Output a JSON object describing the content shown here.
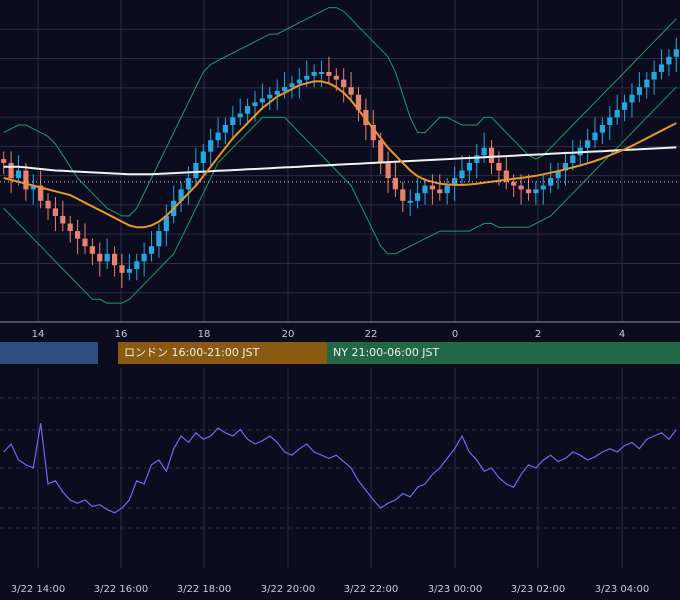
{
  "colors": {
    "background": "#0b0c1e",
    "grid": "#2a2d44",
    "candle_up": "#26a6e0",
    "candle_down": "#e8826e",
    "bollinger": "#1f9a66",
    "ma_orange": "#e8962a",
    "ma_white": "#f2f2f2",
    "oscillator": "#6a6cf0",
    "session_tokyo": "#2c4f80",
    "session_london": "#8a5a12",
    "session_ny": "#226847"
  },
  "sessions": [
    {
      "label": "",
      "color": "#2c4f80"
    },
    {
      "label": "ロンドン 16:00-21:00 JST",
      "color": "#8a5a12"
    },
    {
      "label": "NY 21:00-06:00 JST",
      "color": "#226847"
    }
  ],
  "chart_data": [
    {
      "type": "line",
      "panel": "price",
      "x_ticks": [
        "14",
        "16",
        "18",
        "20",
        "22",
        "0",
        "2",
        "4"
      ],
      "series": [
        {
          "role": "close",
          "style": "candlestick",
          "color_up": "#26a6e0",
          "color_down": "#e8826e",
          "values": [
            62,
            58,
            60,
            55,
            56,
            52,
            50,
            48,
            46,
            44,
            42,
            40,
            38,
            36,
            38,
            35,
            33,
            34,
            36,
            38,
            40,
            44,
            48,
            52,
            55,
            58,
            62,
            65,
            68,
            70,
            72,
            74,
            75,
            77,
            78,
            79,
            80,
            81,
            82,
            83,
            84,
            85,
            86,
            86,
            85,
            84,
            82,
            80,
            76,
            72,
            68,
            62,
            58,
            55,
            52,
            52,
            54,
            56,
            55,
            54,
            56,
            58,
            60,
            62,
            64,
            66,
            62,
            60,
            57,
            56,
            55,
            54,
            55,
            56,
            58,
            60,
            62,
            64,
            66,
            68,
            70,
            72,
            74,
            76,
            78,
            80,
            82,
            84,
            86,
            88,
            90,
            92
          ]
        },
        {
          "role": "moving-average-long",
          "color": "#f2f2f2",
          "values": [
            61,
            61,
            61,
            60.8,
            60.6,
            60.4,
            60.2,
            60,
            59.9,
            59.8,
            59.7,
            59.6,
            59.5,
            59.4,
            59.3,
            59.2,
            59.1,
            59,
            59,
            59,
            59,
            59.1,
            59.2,
            59.3,
            59.4,
            59.5,
            59.6,
            59.7,
            59.8,
            59.9,
            60,
            60.1,
            60.2,
            60.3,
            60.4,
            60.5,
            60.6,
            60.7,
            60.8,
            60.9,
            61,
            61.1,
            61.2,
            61.3,
            61.4,
            61.5,
            61.6,
            61.7,
            61.8,
            61.9,
            62,
            62.1,
            62.2,
            62.3,
            62.4,
            62.5,
            62.6,
            62.7,
            62.8,
            62.9,
            63,
            63.1,
            63.2,
            63.3,
            63.4,
            63.5,
            63.6,
            63.7,
            63.8,
            63.9,
            64,
            64.1,
            64.2,
            64.3,
            64.4,
            64.5,
            64.6,
            64.7,
            64.8,
            64.9,
            65,
            65.1,
            65.2,
            65.3,
            65.4,
            65.5,
            65.6,
            65.7,
            65.8,
            65.9,
            66,
            66.1
          ]
        },
        {
          "role": "moving-average-short",
          "color": "#e8962a",
          "values": [
            58,
            57.5,
            57,
            56.5,
            56,
            55.5,
            55,
            54.5,
            54,
            53.5,
            52.5,
            51.5,
            50.5,
            49.5,
            48.5,
            47.5,
            46.5,
            45.5,
            45,
            45,
            45.5,
            46.5,
            48,
            50,
            52,
            54,
            56,
            58.5,
            61,
            63.5,
            66,
            68.5,
            70.5,
            72.5,
            74.5,
            76.5,
            78,
            79.5,
            80.5,
            81.5,
            82.5,
            83,
            83.5,
            83.5,
            83,
            82,
            80.5,
            78.5,
            76,
            73.5,
            71,
            68.5,
            66,
            64,
            62,
            60,
            58.5,
            57.5,
            57,
            56.5,
            56.3,
            56.2,
            56.2,
            56.3,
            56.5,
            56.8,
            57,
            57.3,
            57.5,
            57.8,
            58,
            58.3,
            58.6,
            59,
            59.4,
            59.8,
            60.3,
            60.8,
            61.3,
            61.9,
            62.5,
            63.2,
            64,
            64.8,
            65.6,
            66.5,
            67.5,
            68.5,
            69.5,
            70.5,
            71.5,
            72.5
          ]
        },
        {
          "role": "bollinger-upper",
          "color": "#1f9a66",
          "values": [
            70,
            71,
            72,
            72,
            71,
            70,
            69,
            67,
            64,
            61,
            58,
            56,
            54,
            52,
            50,
            49,
            48,
            48,
            50,
            54,
            58,
            62,
            66,
            70,
            74,
            78,
            82,
            86,
            88,
            89,
            90,
            91,
            92,
            93,
            94,
            95,
            96,
            96,
            97,
            98,
            99,
            100,
            101,
            102,
            103,
            103,
            102,
            100,
            98,
            96,
            94,
            92,
            90,
            86,
            80,
            74,
            70,
            70,
            72,
            74,
            74,
            73,
            72,
            72,
            72,
            74,
            74,
            72,
            70,
            68,
            66,
            64,
            63,
            64,
            66,
            68,
            70,
            72,
            74,
            76,
            78,
            80,
            82,
            84,
            86,
            88,
            90,
            92,
            94,
            96,
            98,
            100
          ]
        },
        {
          "role": "bollinger-lower",
          "color": "#1f9a66",
          "values": [
            50,
            48,
            46,
            44,
            42,
            40,
            38,
            36,
            34,
            32,
            30,
            28,
            26,
            26,
            25,
            25,
            25,
            26,
            28,
            30,
            32,
            34,
            36,
            38,
            42,
            46,
            50,
            54,
            58,
            62,
            64,
            66,
            68,
            70,
            72,
            74,
            74,
            74,
            74,
            72,
            70,
            68,
            66,
            64,
            62,
            60,
            58,
            56,
            52,
            48,
            44,
            40,
            38,
            38,
            39,
            40,
            41,
            42,
            43,
            44,
            44,
            44,
            44,
            44,
            45,
            46,
            46,
            45,
            45,
            45,
            45,
            45,
            46,
            47,
            48,
            50,
            52,
            54,
            56,
            58,
            60,
            62,
            64,
            66,
            68,
            70,
            72,
            74,
            76,
            78,
            80,
            82
          ]
        }
      ],
      "horizontal_reference": {
        "style": "dotted",
        "color": "#c8ccd8",
        "value": 57
      }
    },
    {
      "type": "line",
      "panel": "oscillator",
      "x_ticks": [
        "3/22 14:00",
        "3/22 16:00",
        "3/22 18:00",
        "3/22 20:00",
        "3/22 22:00",
        "3/23 00:00",
        "3/23 02:00",
        "3/23 04:00"
      ],
      "ylim": [
        0,
        100
      ],
      "series": [
        {
          "color": "#6a6cf0",
          "values": [
            60,
            65,
            55,
            52,
            50,
            78,
            40,
            42,
            35,
            30,
            28,
            30,
            26,
            27,
            24,
            22,
            25,
            30,
            42,
            40,
            52,
            55,
            48,
            62,
            70,
            66,
            72,
            68,
            70,
            75,
            72,
            70,
            74,
            68,
            65,
            67,
            70,
            66,
            60,
            58,
            62,
            65,
            60,
            58,
            56,
            58,
            54,
            50,
            42,
            36,
            30,
            25,
            28,
            30,
            34,
            32,
            38,
            40,
            46,
            50,
            56,
            62,
            70,
            60,
            55,
            48,
            50,
            44,
            40,
            38,
            46,
            52,
            50,
            55,
            58,
            54,
            56,
            60,
            58,
            55,
            57,
            60,
            62,
            60,
            64,
            66,
            62,
            68,
            70,
            72,
            68,
            74
          ]
        }
      ]
    }
  ]
}
